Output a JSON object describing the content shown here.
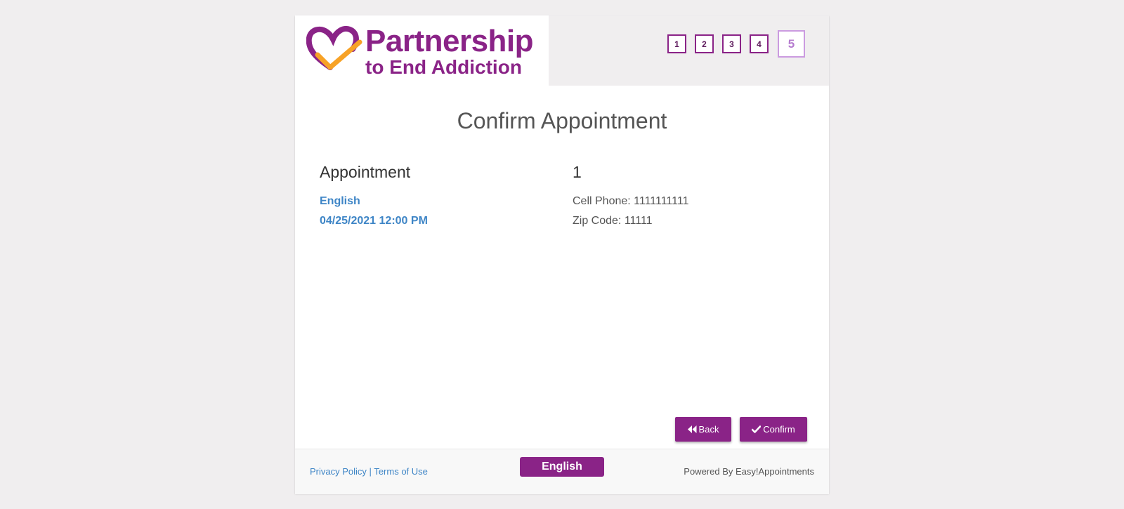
{
  "header": {
    "logo_line1": "Partnership",
    "logo_line2": "to End Addiction",
    "steps": [
      "1",
      "2",
      "3",
      "4",
      "5"
    ],
    "active_step": "5"
  },
  "main": {
    "title": "Confirm Appointment",
    "appointment": {
      "heading": "Appointment",
      "language": "English",
      "datetime": "04/25/2021 12:00 PM"
    },
    "customer": {
      "heading": "1",
      "cell_phone": "Cell Phone: 1111111111",
      "zip_code": "Zip Code: 11111"
    },
    "buttons": {
      "back_label": "Back",
      "confirm_label": "Confirm"
    }
  },
  "footer": {
    "privacy": "Privacy Policy",
    "separator": "|",
    "terms": "Terms of Use",
    "language_button": "English",
    "powered_by": "Powered By Easy!Appointments"
  },
  "colors": {
    "brand": "#8a2387",
    "link": "#3e85c6",
    "accent_orange": "#f7a226",
    "active_step_border": "#cb9be0"
  },
  "icons": {
    "logo": "heart-check-logo",
    "back": "double-chevron-left-icon",
    "confirm": "check-icon"
  }
}
